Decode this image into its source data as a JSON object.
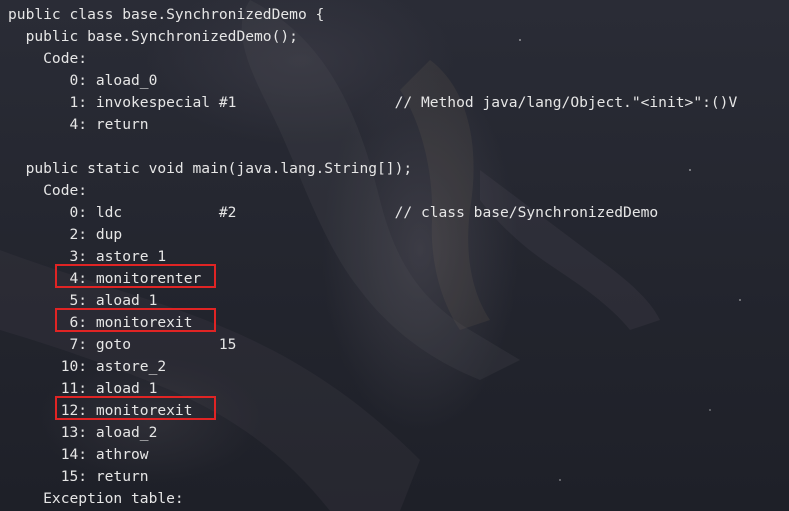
{
  "terminal": {
    "lines": [
      "public class base.SynchronizedDemo {",
      "  public base.SynchronizedDemo();",
      "    Code:",
      "       0: aload_0",
      "       1: invokespecial #1                  // Method java/lang/Object.\"<init>\":()V",
      "       4: return",
      "",
      "  public static void main(java.lang.String[]);",
      "    Code:",
      "       0: ldc           #2                  // class base/SynchronizedDemo",
      "       2: dup",
      "       3: astore_1",
      "       4: monitorenter",
      "       5: aload_1",
      "       6: monitorexit",
      "       7: goto          15",
      "      10: astore_2",
      "      11: aload_1",
      "      12: monitorexit",
      "      13: aload_2",
      "      14: athrow",
      "      15: return",
      "    Exception table:"
    ]
  },
  "highlight_color": "#e02424",
  "text_color": "#e6e6e6"
}
